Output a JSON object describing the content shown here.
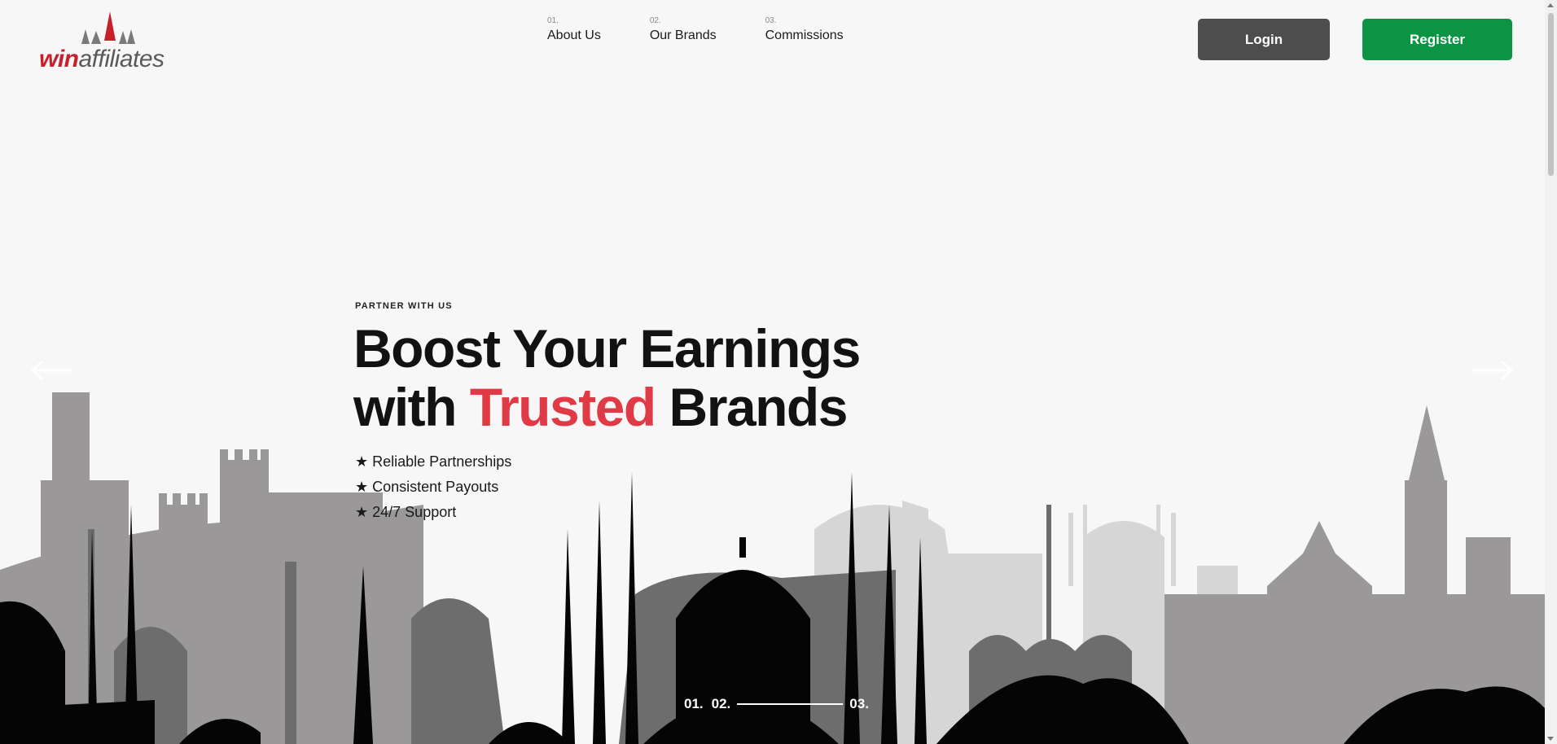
{
  "brand": {
    "name_part1": "win",
    "name_part2": "affiliates",
    "brand_color": "#c8202b"
  },
  "nav": {
    "items": [
      {
        "num": "01.",
        "label": "About Us"
      },
      {
        "num": "02.",
        "label": "Our Brands"
      },
      {
        "num": "03.",
        "label": "Commissions"
      }
    ]
  },
  "auth": {
    "login_label": "Login",
    "register_label": "Register",
    "login_color": "#4d4d4d",
    "register_color": "#0b9444"
  },
  "hero": {
    "eyebrow": "PARTNER WITH US",
    "headline_line1": "Boost Your Earnings",
    "headline_with": "with",
    "headline_accent": "Trusted",
    "headline_end": "Brands",
    "accent_color": "#e13a47",
    "features": [
      "Reliable Partnerships",
      "Consistent Payouts",
      "24/7 Support"
    ],
    "feature_icon": "star-icon"
  },
  "carousel": {
    "prev_icon": "arrow-left-icon",
    "next_icon": "arrow-right-icon",
    "slides": [
      "01.",
      "02.",
      "03."
    ],
    "active_slide": 2
  }
}
